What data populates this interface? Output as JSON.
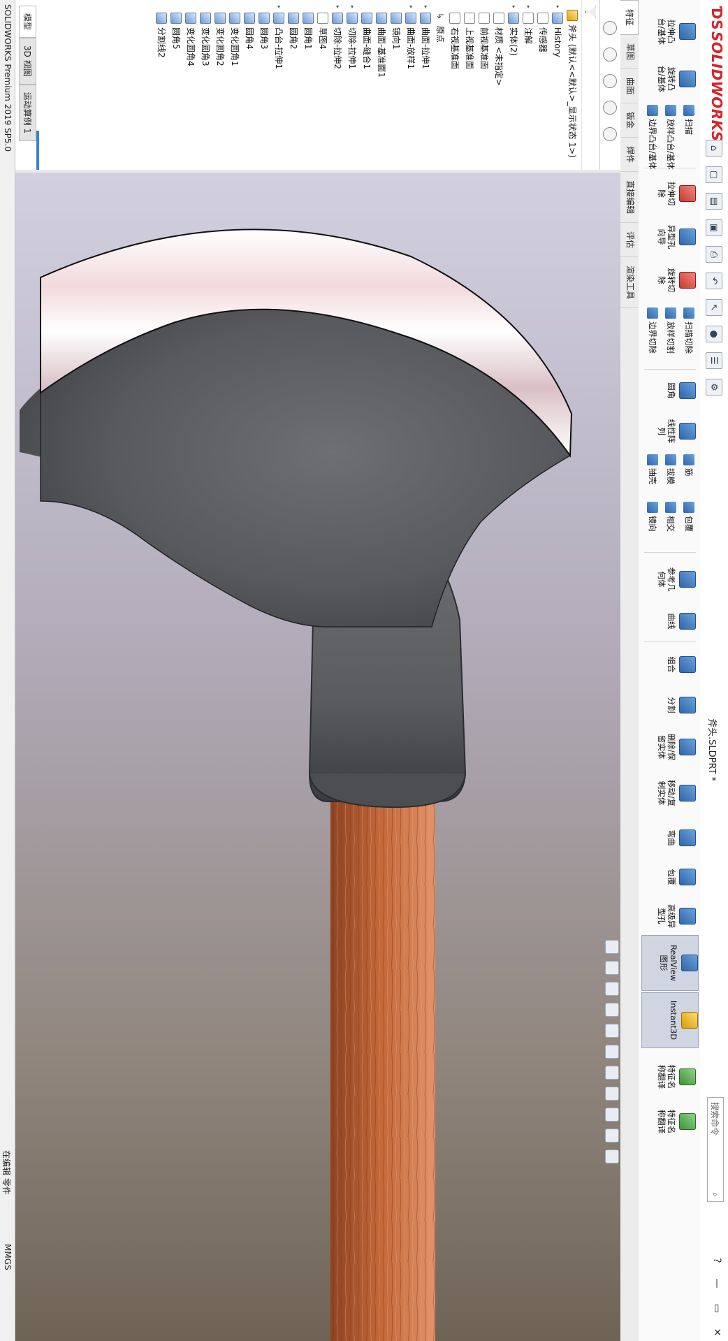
{
  "app": {
    "brand": "SOLIDWORKS",
    "document_title": "斧头.SLDPRT *",
    "search_placeholder": "搜索命令",
    "accent": "#d8232a"
  },
  "ribbon": {
    "extrude_boss": "拉伸凸\n台/基体",
    "revolve_boss": "旋转凸\n台/基体",
    "sweep": "扫描",
    "loft": "放样凸台/基体",
    "boundary_boss": "边界凸台/基体",
    "extrude_cut": "拉伸切\n除",
    "hole_wizard": "异型孔\n向导",
    "revolve_cut": "旋转切\n除",
    "swept_cut": "扫描切除",
    "lofted_cut": "放样切割",
    "boundary_cut": "边界切除",
    "fillet": "圆角",
    "linear_pattern": "线性阵\n列",
    "rib": "筋",
    "draft": "拔模",
    "shell": "抽壳",
    "wrap": "包覆",
    "intersect": "相交",
    "mirror": "镜向",
    "ref_geometry": "参考几\n何体",
    "curves": "曲线",
    "combine": "组合",
    "split": "分割",
    "delete_keep_body": "删除/保\n留实体",
    "move_copy_body": "移动/复\n制实体",
    "flex": "弯曲",
    "wrap2": "包覆",
    "hole_series": "高级异\n型孔",
    "realview": "RealView\n图形",
    "instant3d": "Instant3D",
    "feature_trans1": "特征名\n称翻译",
    "feature_trans2": "特征名\n称翻译"
  },
  "tabs": [
    "特征",
    "草图",
    "曲面",
    "钣金",
    "焊件",
    "直接编辑",
    "评估",
    "渲染工具"
  ],
  "tree": {
    "root": "斧头 (默认<<默认>_显示状态 1>)",
    "items": [
      {
        "label": "History",
        "icon": "feat",
        "toggle": "▸"
      },
      {
        "label": "传感器",
        "icon": "sk",
        "toggle": ""
      },
      {
        "label": "注解",
        "icon": "sk",
        "toggle": "▸"
      },
      {
        "label": "实体(2)",
        "icon": "feat",
        "toggle": "▸"
      },
      {
        "label": "材质 <未指定>",
        "icon": "sk",
        "toggle": ""
      },
      {
        "label": "前视基准面",
        "icon": "sk",
        "toggle": ""
      },
      {
        "label": "上视基准面",
        "icon": "sk",
        "toggle": ""
      },
      {
        "label": "右视基准面",
        "icon": "sk",
        "toggle": ""
      },
      {
        "label": "原点",
        "icon": "org",
        "toggle": ""
      },
      {
        "label": "曲面-拉伸1",
        "icon": "feat",
        "toggle": "▸"
      },
      {
        "label": "曲面-放样1",
        "icon": "feat",
        "toggle": "▸"
      },
      {
        "label": "镜向1",
        "icon": "feat",
        "toggle": ""
      },
      {
        "label": "曲面-基准面1",
        "icon": "feat",
        "toggle": ""
      },
      {
        "label": "曲面-缝合1",
        "icon": "feat",
        "toggle": ""
      },
      {
        "label": "切除-拉伸1",
        "icon": "feat",
        "toggle": "▸"
      },
      {
        "label": "切除-拉伸2",
        "icon": "feat",
        "toggle": "▸"
      },
      {
        "label": "草图4",
        "icon": "sk",
        "toggle": ""
      },
      {
        "label": "圆角1",
        "icon": "feat",
        "toggle": ""
      },
      {
        "label": "圆角2",
        "icon": "feat",
        "toggle": ""
      },
      {
        "label": "凸台-拉伸1",
        "icon": "feat",
        "toggle": "▸"
      },
      {
        "label": "圆角3",
        "icon": "feat",
        "toggle": ""
      },
      {
        "label": "圆角4",
        "icon": "feat",
        "toggle": ""
      },
      {
        "label": "变化圆角1",
        "icon": "feat",
        "toggle": ""
      },
      {
        "label": "变化圆角2",
        "icon": "feat",
        "toggle": ""
      },
      {
        "label": "变化圆角3",
        "icon": "feat",
        "toggle": ""
      },
      {
        "label": "变化圆角4",
        "icon": "feat",
        "toggle": ""
      },
      {
        "label": "圆角5",
        "icon": "feat",
        "toggle": ""
      },
      {
        "label": "分割线2",
        "icon": "feat",
        "toggle": ""
      }
    ]
  },
  "bottom_tabs": [
    "模型",
    "3D 视图",
    "运动算例 1"
  ],
  "status": {
    "version": "SOLIDWORKS Premium 2019 SP5.0",
    "mode": "在编辑 零件",
    "units": "MMGS"
  },
  "colors": {
    "blade": "#5a5c5e",
    "edge": "#f4f0f2",
    "handle": "#c46a3c"
  }
}
